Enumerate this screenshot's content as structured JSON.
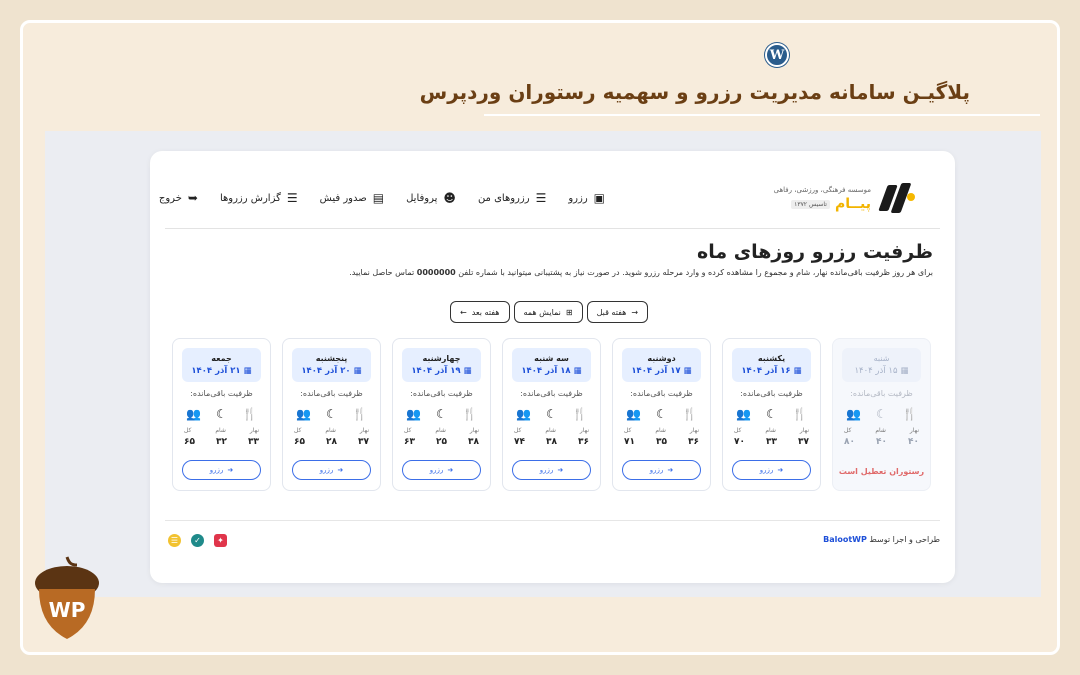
{
  "promo": {
    "headline": "پلاگیـن سامانه مدیریت رزرو و سهمیه رستوران وردپرس",
    "wp_logo_letter": "W",
    "corner_logo_text": "WP"
  },
  "brand": {
    "subtitle": "موسسه فرهنگی، ورزشی، رفاهی",
    "name": "پیــام",
    "est": "تاسیس ۱۳۷۲"
  },
  "nav": {
    "items": [
      {
        "label": "رزرو",
        "icon": "calendar-check-icon",
        "glyph": "▣"
      },
      {
        "label": "رزروهای من",
        "icon": "list-check-icon",
        "glyph": "☰"
      },
      {
        "label": "پروفایل",
        "icon": "user-gear-icon",
        "glyph": "☻"
      },
      {
        "label": "صدور فیش",
        "icon": "receipt-icon",
        "glyph": "▤"
      },
      {
        "label": "گزارش رزروها",
        "icon": "list-report-icon",
        "glyph": "☰"
      },
      {
        "label": "خروج",
        "icon": "logout-icon",
        "glyph": "➥"
      }
    ]
  },
  "page": {
    "title": "ظرفیت رزرو روزهای ماه",
    "desc_before": "برای هر روز ظرفیت باقی‌مانده نهار، شام و مجموع را مشاهده کرده و وارد مرحله رزرو شوید. در صورت نیاز به پشتیبانی میتوانید با شماره تلفن",
    "phone": "0000000",
    "desc_after": "تماس حاصل نمایید."
  },
  "week_nav": {
    "prev": "هفته قبل",
    "all": "نمایش همه",
    "next": "هفته بعد"
  },
  "day_labels": {
    "capacity": "ظرفیت باقی‌مانده:",
    "lunch": "نهار",
    "dinner": "شام",
    "total": "کل",
    "reserve": "رزرو",
    "closed": "رستوران تعطیل است"
  },
  "days": [
    {
      "name": "شنبه",
      "date": "۱۵ آذر ۱۴۰۴",
      "lunch": "۴۰",
      "dinner": "۴۰",
      "total": "۸۰",
      "closed": true
    },
    {
      "name": "یکشنبه",
      "date": "۱۶ آذر ۱۴۰۴",
      "lunch": "۳۷",
      "dinner": "۳۳",
      "total": "۷۰",
      "closed": false
    },
    {
      "name": "دوشنبه",
      "date": "۱۷ آذر ۱۴۰۴",
      "lunch": "۳۶",
      "dinner": "۳۵",
      "total": "۷۱",
      "closed": false
    },
    {
      "name": "سه شنبه",
      "date": "۱۸ آذر ۱۴۰۴",
      "lunch": "۳۶",
      "dinner": "۳۸",
      "total": "۷۴",
      "closed": false
    },
    {
      "name": "چهارشنبه",
      "date": "۱۹ آذر ۱۴۰۴",
      "lunch": "۳۸",
      "dinner": "۲۵",
      "total": "۶۳",
      "closed": false
    },
    {
      "name": "پنجشنبه",
      "date": "۲۰ آذر ۱۴۰۴",
      "lunch": "۳۷",
      "dinner": "۲۸",
      "total": "۶۵",
      "closed": false
    },
    {
      "name": "جمعه",
      "date": "۲۱ آذر ۱۴۰۴",
      "lunch": "۳۳",
      "dinner": "۳۲",
      "total": "۶۵",
      "closed": false
    }
  ],
  "footer": {
    "credit_prefix": "طراحی و اجرا توسط",
    "credit_brand": "BalootWP"
  },
  "colors": {
    "accent_blue": "#1d4fd8",
    "brand_yellow": "#f2b400",
    "closed_red": "#e06a6a",
    "headline_brown": "#6b3f14"
  }
}
